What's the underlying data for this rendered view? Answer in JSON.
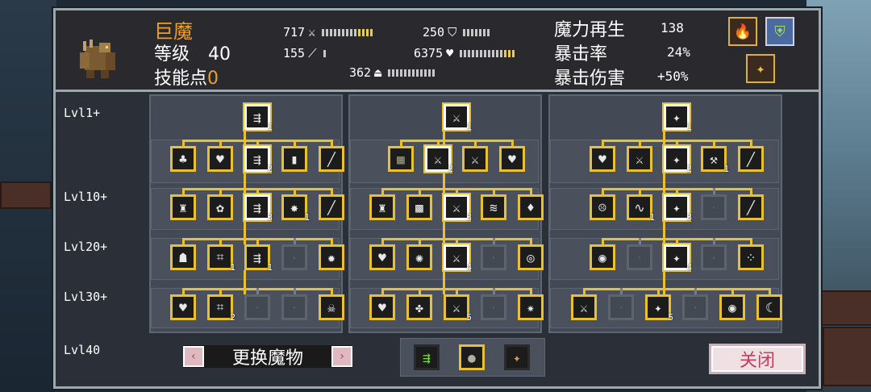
{
  "monster": {
    "name": "巨魔",
    "level_label": "等级",
    "level": "40",
    "skill_label": "技能点",
    "skill_points": "0"
  },
  "stats": {
    "attack": "717",
    "magic": "155",
    "defense": "250",
    "health": "6375",
    "speed": "362"
  },
  "right_stats": [
    {
      "label": "魔力再生",
      "value": "138"
    },
    {
      "label": "暴击率",
      "value": "24%"
    },
    {
      "label": "暴击伤害",
      "value": "+50%"
    }
  ],
  "levels": [
    "Lvl1+",
    "Lvl10+",
    "Lvl20+",
    "Lvl30+",
    "Lvl40"
  ],
  "trees": [
    {
      "rows": [
        [
          {
            "icon": "⇶",
            "cnt": "1",
            "hl": true
          }
        ],
        [
          {
            "icon": "♣"
          },
          {
            "icon": "♥"
          },
          {
            "icon": "⇶",
            "cnt": "2",
            "hl": true
          },
          {
            "icon": "▮"
          },
          {
            "icon": "╱"
          }
        ],
        [
          {
            "icon": "♜"
          },
          {
            "icon": "✿"
          },
          {
            "icon": "⇶",
            "cnt": "3",
            "hl": true
          },
          {
            "icon": "✸",
            "cnt": "1"
          },
          {
            "icon": "╱"
          }
        ],
        [
          {
            "icon": "☗"
          },
          {
            "icon": "⌗",
            "cnt": "1"
          },
          {
            "icon": "⇶",
            "cnt": "1"
          },
          {
            "icon": "·",
            "dim": true
          },
          {
            "icon": "✹"
          }
        ],
        [
          {
            "icon": "♥"
          },
          {
            "icon": "⌗",
            "cnt": "2"
          },
          {
            "icon": "·",
            "dim": true
          },
          {
            "icon": "·",
            "dim": true
          },
          {
            "icon": "☠"
          }
        ]
      ]
    },
    {
      "rows": [
        [
          {
            "icon": "⚔",
            "cnt": "1",
            "hl": true
          }
        ],
        [
          {
            "icon": "▦",
            "dim2": true
          },
          {
            "icon": "⚔",
            "cnt": "2",
            "hl": true
          },
          {
            "icon": "⚔"
          },
          {
            "icon": "♥"
          }
        ],
        [
          {
            "icon": "♜"
          },
          {
            "icon": "▩"
          },
          {
            "icon": "⚔",
            "cnt": "3",
            "hl": true
          },
          {
            "icon": "≋"
          },
          {
            "icon": "♦"
          }
        ],
        [
          {
            "icon": "♥"
          },
          {
            "icon": "✺"
          },
          {
            "icon": "⚔",
            "cnt": "4",
            "hl": true
          },
          {
            "icon": "·",
            "dim": true
          },
          {
            "icon": "◎"
          }
        ],
        [
          {
            "icon": "♥"
          },
          {
            "icon": "✤"
          },
          {
            "icon": "⚔",
            "cnt": "5"
          },
          {
            "icon": "·",
            "dim": true
          },
          {
            "icon": "✷"
          }
        ]
      ]
    },
    {
      "rows": [
        [
          {
            "icon": "✦",
            "cnt": "1",
            "hl": true
          }
        ],
        [
          {
            "icon": "♥"
          },
          {
            "icon": "⚔"
          },
          {
            "icon": "✦",
            "cnt": "2",
            "hl": true
          },
          {
            "icon": "⚒",
            "cnt": "1"
          },
          {
            "icon": "╱"
          }
        ],
        [
          {
            "icon": "☹"
          },
          {
            "icon": "∿",
            "cnt": "1"
          },
          {
            "icon": "✦",
            "cnt": "3",
            "hl": true
          },
          {
            "icon": "·",
            "dim": true
          },
          {
            "icon": "╱"
          }
        ],
        [
          {
            "icon": "◉"
          },
          {
            "icon": "·",
            "dim": true
          },
          {
            "icon": "✦",
            "cnt": "4",
            "hl": true
          },
          {
            "icon": "·",
            "dim": true
          },
          {
            "icon": "⁘"
          }
        ],
        [
          {
            "icon": "⚔"
          },
          {
            "icon": "·",
            "dim": true
          },
          {
            "icon": "✦",
            "cnt": "5"
          },
          {
            "icon": "·",
            "dim": true
          },
          {
            "icon": "◉"
          },
          {
            "icon": "☾"
          }
        ]
      ]
    }
  ],
  "bottom": {
    "swap_label": "更换魔物",
    "prev": "‹",
    "next": "›",
    "close_label": "关闭"
  }
}
